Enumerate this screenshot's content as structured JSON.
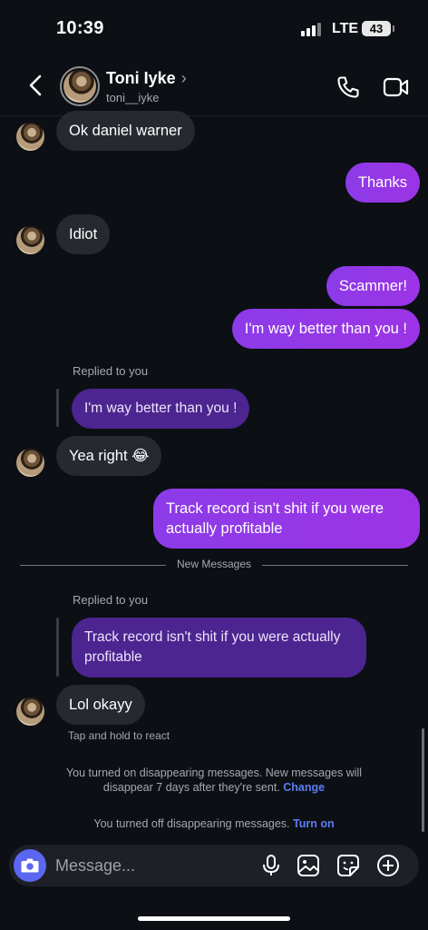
{
  "status_bar": {
    "time": "10:39",
    "network": "LTE",
    "battery": "43"
  },
  "header": {
    "name": "Toni Iyke",
    "username": "toni__iyke"
  },
  "messages": {
    "m1": "Ok daniel warner",
    "m2": "Thanks",
    "m3": "Idiot",
    "m4": "Scammer!",
    "m5": "I'm way better than you !",
    "reply1_label": "Replied to you",
    "reply1_quote": "I'm way better than you !",
    "m6": "Yea right 😂",
    "m7_line1": "Track record isn't shit if you were",
    "m7_line2": "actually profitable",
    "divider": "New Messages",
    "reply2_label": "Replied to you",
    "reply2_line1": "Track record isn't shit if you were actually",
    "reply2_line2": "profitable",
    "m8": "Lol okayy",
    "tap_hold": "Tap and hold to react"
  },
  "system": {
    "on_text_1": "You turned on disappearing messages. New messages will",
    "on_text_2": "disappear 7 days after they're sent.",
    "on_link": "Change",
    "off_text": "You turned off disappearing messages.",
    "off_link": "Turn on"
  },
  "composer": {
    "placeholder": "Message..."
  },
  "colors": {
    "outgoing": "#9333ea",
    "incoming": "#262930",
    "reply_quote": "#4c2590",
    "link": "#5b7df5",
    "background": "#0c0f14"
  },
  "icons": [
    "back-chevron-icon",
    "chevron-right-icon",
    "phone-icon",
    "video-camera-icon",
    "camera-icon",
    "microphone-icon",
    "gallery-icon",
    "sticker-icon",
    "plus-circle-icon"
  ]
}
